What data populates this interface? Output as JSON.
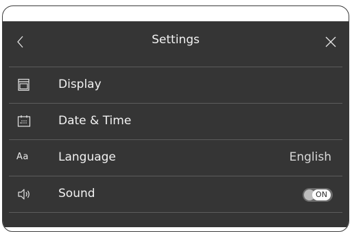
{
  "header": {
    "title": "Settings",
    "back_icon": "chevron-left-icon",
    "close_icon": "close-icon"
  },
  "menu": {
    "items": [
      {
        "label": "Display",
        "icon": "display-icon"
      },
      {
        "label": "Date & Time",
        "icon": "calendar-icon"
      },
      {
        "label": "Language",
        "icon_text": "Aa",
        "value": "English"
      },
      {
        "label": "Sound",
        "icon": "speaker-icon",
        "toggle_state": "ON"
      }
    ]
  },
  "colors": {
    "screen_bg": "#353535",
    "divider": "#5d5d5d",
    "text": "#f2f2f2"
  }
}
